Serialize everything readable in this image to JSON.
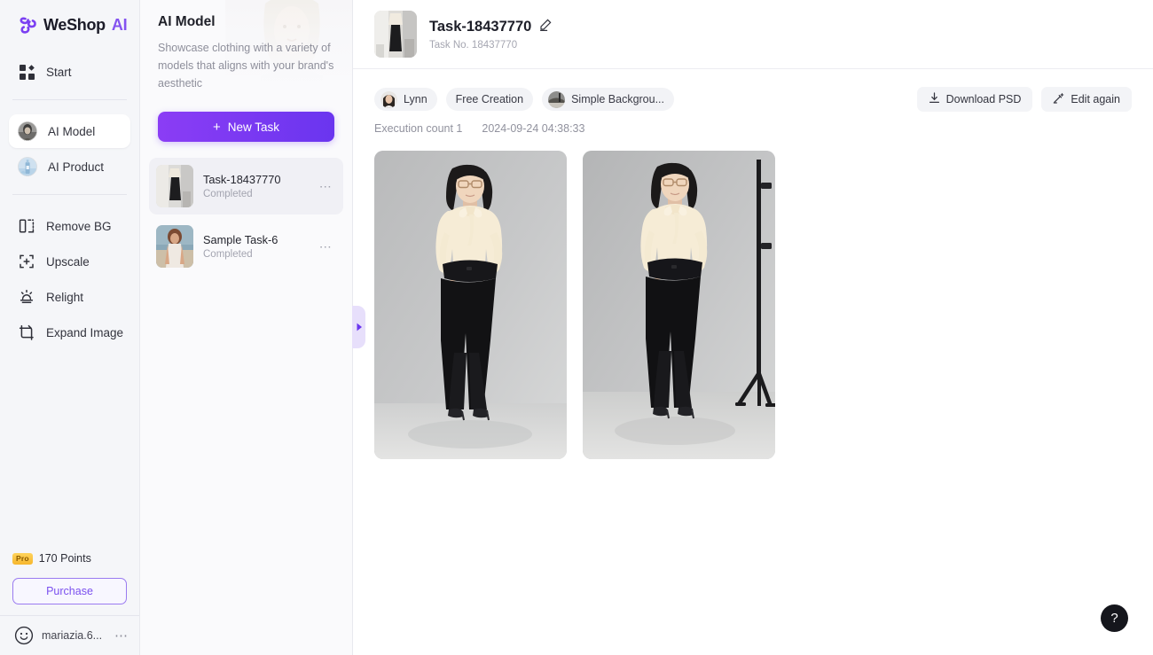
{
  "brand": {
    "name": "WeShop",
    "suffix": "AI",
    "logo_icon": "weshop-logo-icon"
  },
  "sidebar": {
    "top_items": [
      {
        "label": "Start",
        "icon": "grid-start-icon"
      }
    ],
    "model_items": [
      {
        "label": "AI Model",
        "icon": "ai-model-avatar-icon",
        "active": true
      },
      {
        "label": "AI Product",
        "icon": "ai-product-avatar-icon",
        "active": false
      }
    ],
    "tool_items": [
      {
        "label": "Remove BG",
        "icon": "remove-bg-icon"
      },
      {
        "label": "Upscale",
        "icon": "upscale-icon"
      },
      {
        "label": "Relight",
        "icon": "relight-icon"
      },
      {
        "label": "Expand Image",
        "icon": "expand-image-icon"
      }
    ],
    "points": {
      "badge": "Pro",
      "text": "170 Points"
    },
    "purchase_label": "Purchase",
    "user": {
      "name": "mariazia.6...",
      "menu_icon": "more-dots-icon",
      "avatar_icon": "smiley-avatar-icon"
    }
  },
  "task_panel": {
    "title": "AI Model",
    "description": "Showcase clothing with a variety of models that aligns with your brand's aesthetic",
    "new_task_label": "New Task",
    "new_task_plus": "+",
    "tasks": [
      {
        "name": "Task-18437770",
        "status": "Completed",
        "menu_icon": "more-dots-icon",
        "active": true
      },
      {
        "name": "Sample Task-6",
        "status": "Completed",
        "menu_icon": "more-dots-icon",
        "active": false
      }
    ],
    "collapse_icon": "collapse-panel-arrow-icon"
  },
  "header": {
    "title": "Task-18437770",
    "subtitle": "Task No. 18437770",
    "edit_icon": "pencil-edit-icon",
    "thumbnail_icon": "task-thumbnail-image"
  },
  "detail": {
    "chips": [
      {
        "label": "Lynn",
        "icon": "model-avatar-icon",
        "has_avatar": true
      },
      {
        "label": "Free Creation",
        "icon": "",
        "has_avatar": false
      },
      {
        "label": "Simple Backgrou...",
        "icon": "background-thumb-icon",
        "has_avatar": true
      }
    ],
    "actions": [
      {
        "label": "Download PSD",
        "icon": "download-icon"
      },
      {
        "label": "Edit again",
        "icon": "magic-wand-icon"
      }
    ],
    "execution_count": "Execution count 1",
    "timestamp": "2024-09-24 04:38:33",
    "images": [
      {
        "name": "generated-image-1",
        "alt": "Model in cream blouse and black flared trousers on grey backdrop"
      },
      {
        "name": "generated-image-2",
        "alt": "Model in cream blouse and black flared trousers with studio light stand"
      }
    ]
  },
  "help": {
    "label": "?"
  },
  "colors": {
    "accent_purple": "#7035ef",
    "brand_purple": "#8453f0",
    "sidebar_bg": "#f5f6f9",
    "panel_bg": "#fafafc",
    "chip_bg": "#f2f3f6",
    "pro_gold": "#f6b62c"
  }
}
